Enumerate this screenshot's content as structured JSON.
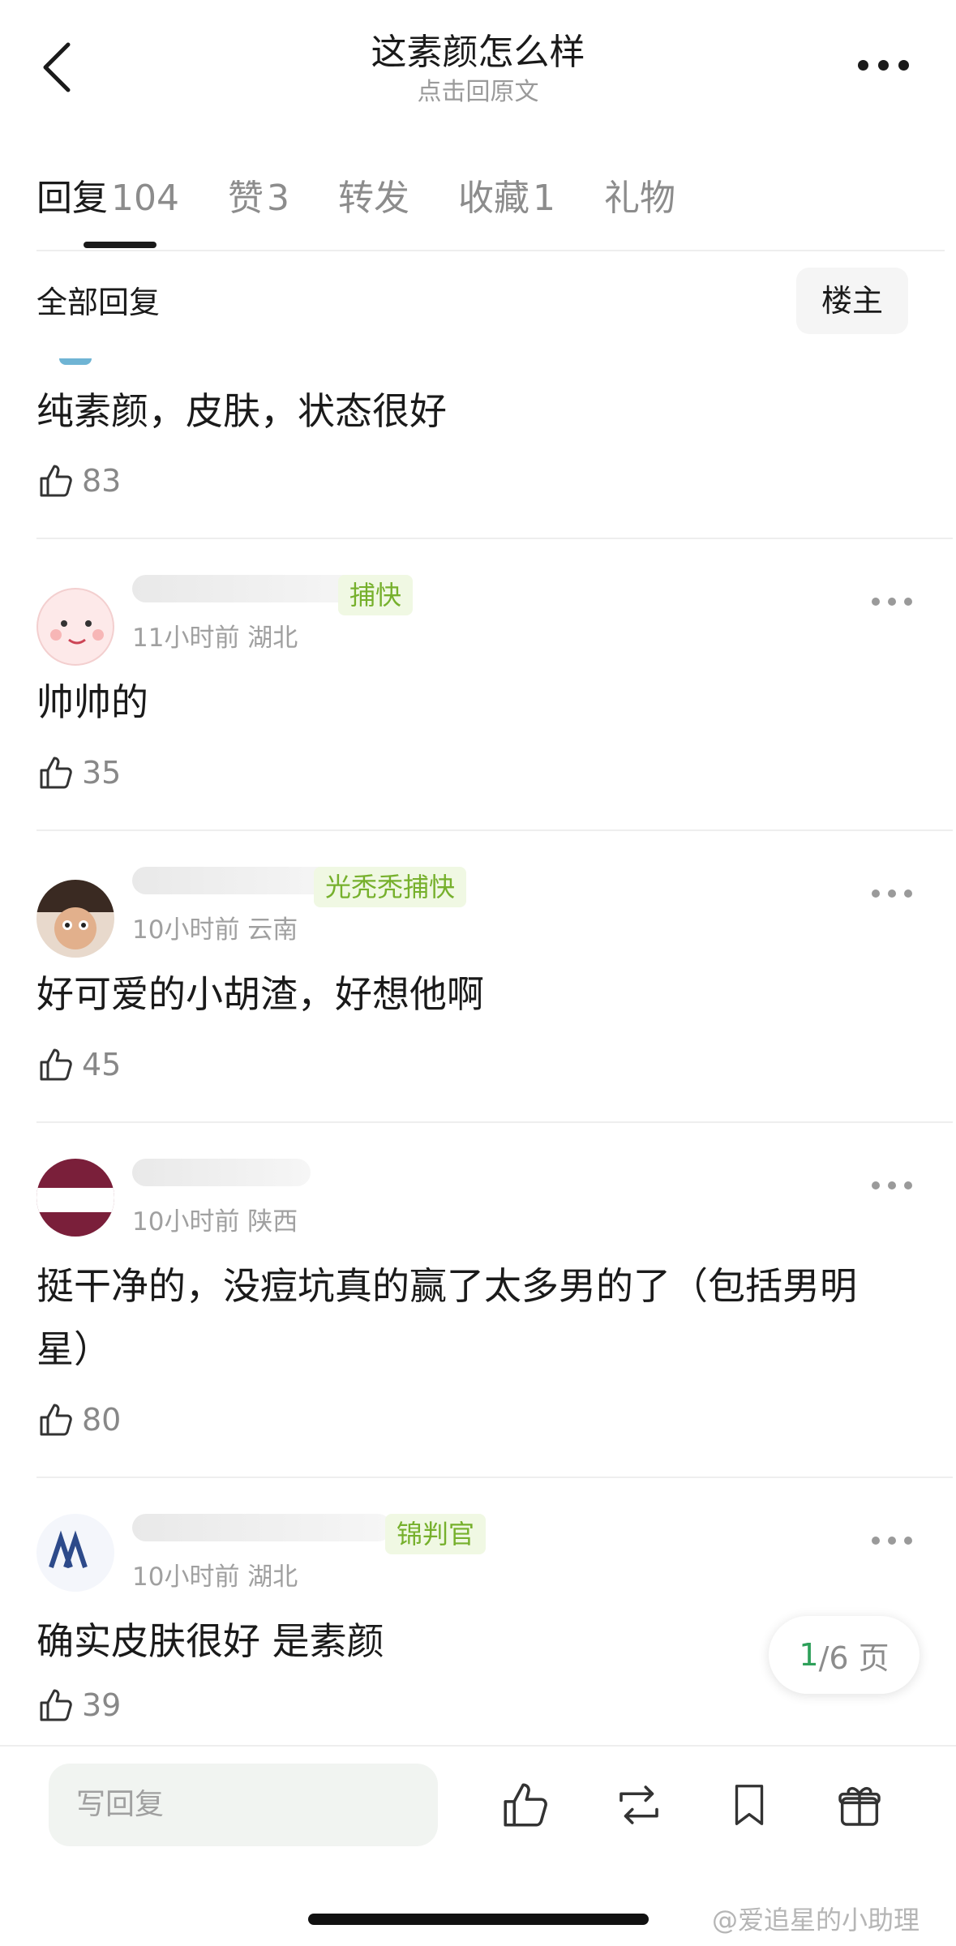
{
  "header": {
    "title": "这素颜怎么样",
    "subtitle": "点击回原文"
  },
  "tabs": [
    {
      "label": "回复",
      "count": "104",
      "active": true
    },
    {
      "label": "赞",
      "count": "3"
    },
    {
      "label": "转发",
      "count": ""
    },
    {
      "label": "收藏",
      "count": "1"
    },
    {
      "label": "礼物",
      "count": ""
    }
  ],
  "filter": {
    "label": "全部回复",
    "op_button": "楼主"
  },
  "comments": [
    {
      "meta": "",
      "badge": "",
      "text": "纯素颜，皮肤，状态很好",
      "likes": "83"
    },
    {
      "meta": "11小时前 湖北",
      "badge": "捕快",
      "text": "帅帅的",
      "likes": "35"
    },
    {
      "meta": "10小时前 云南",
      "badge": "光秃秃捕快",
      "text": "好可爱的小胡渣，好想他啊",
      "likes": "45"
    },
    {
      "meta": "10小时前 陕西",
      "badge": "",
      "text_line1": "挺干净的，没痘坑真的赢了太多男的了（包括男明",
      "text_line2": "星）",
      "likes": "80"
    },
    {
      "meta": "10小时前 湖北",
      "badge": "锦判官",
      "text": "确实皮肤很好 是素颜",
      "likes": "39"
    }
  ],
  "pagination": {
    "current": "1",
    "total": "/6 页"
  },
  "bottom_bar": {
    "reply_placeholder": "写回复"
  },
  "watermark": "@爱追星的小助理",
  "colors": {
    "accent_green": "#2ea05a",
    "badge_green": "#76b02c",
    "text_primary": "#1a1a1a",
    "text_secondary": "#9a9a9a"
  },
  "icons": {
    "back": "chevron-left-icon",
    "more": "more-horizontal-icon",
    "like": "thumbs-up-icon",
    "repost": "repost-icon",
    "bookmark": "bookmark-icon",
    "gift": "gift-icon"
  }
}
